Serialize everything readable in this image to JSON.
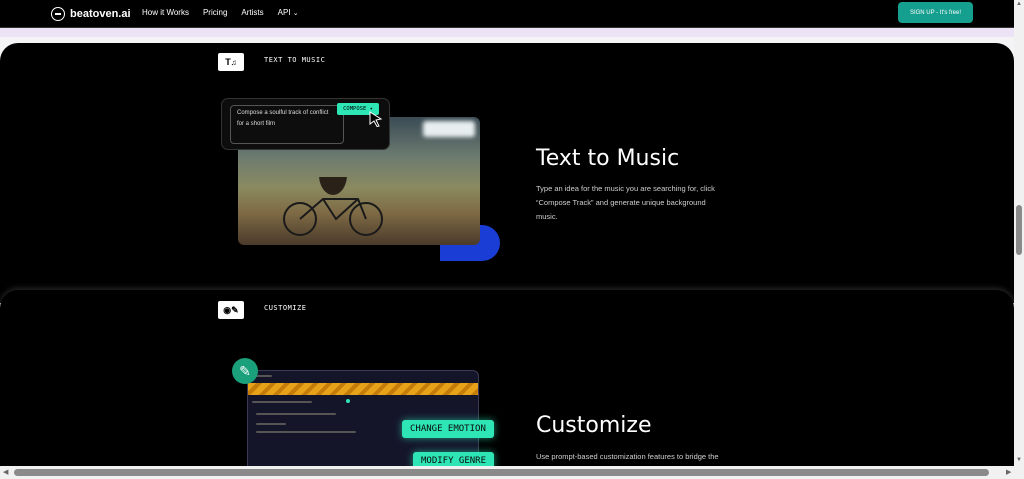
{
  "header": {
    "logo_text": "beatoven.ai",
    "nav": [
      "How it Works",
      "Pricing",
      "Artists",
      "API"
    ],
    "api_chevron": "chevron-down-icon",
    "signup_label": "SIGN UP - It's free!",
    "signup_color": "#159f8f"
  },
  "text_to_music": {
    "label": "TEXT TO MUSIC",
    "icon_text": "T",
    "prompt_text": "Compose a soulful track of conflict for a short film",
    "compose_label": "COMPOSE",
    "heading": "Text to Music",
    "description": "Type an idea for the music you are searching for, click “Compose Track” and generate unique background music.",
    "accent": "#2ee5b5"
  },
  "customize": {
    "label": "CUSTOMIZE",
    "heading": "Customize",
    "description": "Use prompt-based customization features to bridge the gap between your creative vision and the output. Make",
    "tags": [
      "CHANGE EMOTION",
      "MODIFY GENRE"
    ]
  }
}
